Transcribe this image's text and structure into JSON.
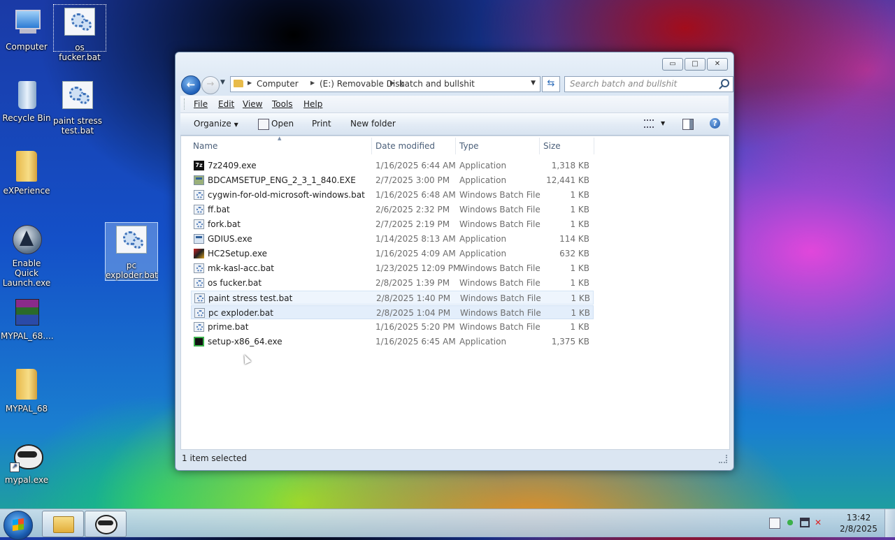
{
  "desktop": {
    "icons": [
      {
        "label": "Computer"
      },
      {
        "label": "os fucker.bat"
      },
      {
        "label": "Recycle Bin"
      },
      {
        "label": "paint stress test.bat"
      },
      {
        "label": "eXPerience"
      },
      {
        "label": "Enable Quick Launch.exe"
      },
      {
        "label": "pc exploder.bat"
      },
      {
        "label": "MYPAL_68...."
      },
      {
        "label": "MYPAL_68"
      },
      {
        "label": "mypal.exe"
      }
    ]
  },
  "window": {
    "controls": {
      "minimize": "▭",
      "maximize": "□",
      "close": "✕"
    },
    "nav": {
      "back": "←",
      "forward": "→",
      "refresh": "⇆"
    },
    "breadcrumb": [
      "Computer",
      "(E:) Removable Disk",
      "batch and bullshit"
    ],
    "search_placeholder": "Search batch and bullshit",
    "menu": [
      "File",
      "Edit",
      "View",
      "Tools",
      "Help"
    ],
    "toolbar": {
      "organize": "Organize",
      "open": "Open",
      "print": "Print",
      "new_folder": "New folder",
      "help": "?"
    },
    "columns": [
      "Name",
      "Date modified",
      "Type",
      "Size"
    ],
    "files": [
      {
        "name": "7z2409.exe",
        "date": "1/16/2025 6:44 AM",
        "type": "Application",
        "size": "1,318 KB",
        "icon": "7z-icon"
      },
      {
        "name": "BDCAMSETUP_ENG_2_3_1_840.EXE",
        "date": "2/7/2025 3:00 PM",
        "type": "Application",
        "size": "12,441 KB",
        "icon": "installer-icon"
      },
      {
        "name": "cygwin-for-old-microsoft-windows.bat",
        "date": "1/16/2025 6:48 AM",
        "type": "Windows Batch File",
        "size": "1 KB",
        "icon": "batch-file-icon"
      },
      {
        "name": "ff.bat",
        "date": "2/6/2025 2:32 PM",
        "type": "Windows Batch File",
        "size": "1 KB",
        "icon": "batch-file-icon"
      },
      {
        "name": "fork.bat",
        "date": "2/7/2025 2:19 PM",
        "type": "Windows Batch File",
        "size": "1 KB",
        "icon": "batch-file-icon"
      },
      {
        "name": "GDIUS.exe",
        "date": "1/14/2025 8:13 AM",
        "type": "Application",
        "size": "114 KB",
        "icon": "application-icon"
      },
      {
        "name": "HC2Setup.exe",
        "date": "1/16/2025 4:09 AM",
        "type": "Application",
        "size": "632 KB",
        "icon": "setup-icon"
      },
      {
        "name": "mk-kasl-acc.bat",
        "date": "1/23/2025 12:09 PM",
        "type": "Windows Batch File",
        "size": "1 KB",
        "icon": "batch-file-icon"
      },
      {
        "name": "os fucker.bat",
        "date": "2/8/2025 1:39 PM",
        "type": "Windows Batch File",
        "size": "1 KB",
        "icon": "batch-file-icon"
      },
      {
        "name": "paint stress test.bat",
        "date": "2/8/2025 1:40 PM",
        "type": "Windows Batch File",
        "size": "1 KB",
        "icon": "batch-file-icon"
      },
      {
        "name": "pc exploder.bat",
        "date": "2/8/2025 1:04 PM",
        "type": "Windows Batch File",
        "size": "1 KB",
        "icon": "batch-file-icon"
      },
      {
        "name": "prime.bat",
        "date": "1/16/2025 5:20 PM",
        "type": "Windows Batch File",
        "size": "1 KB",
        "icon": "batch-file-icon"
      },
      {
        "name": "setup-x86_64.exe",
        "date": "1/16/2025 6:45 AM",
        "type": "Application",
        "size": "1,375 KB",
        "icon": "cygwin-setup-icon"
      }
    ],
    "status": "1 item selected"
  },
  "taskbar": {
    "clock_time": "13:42",
    "clock_date": "2/8/2025"
  },
  "colors": {
    "accent": "#1e5fb8",
    "selection": "#e3eefb"
  }
}
